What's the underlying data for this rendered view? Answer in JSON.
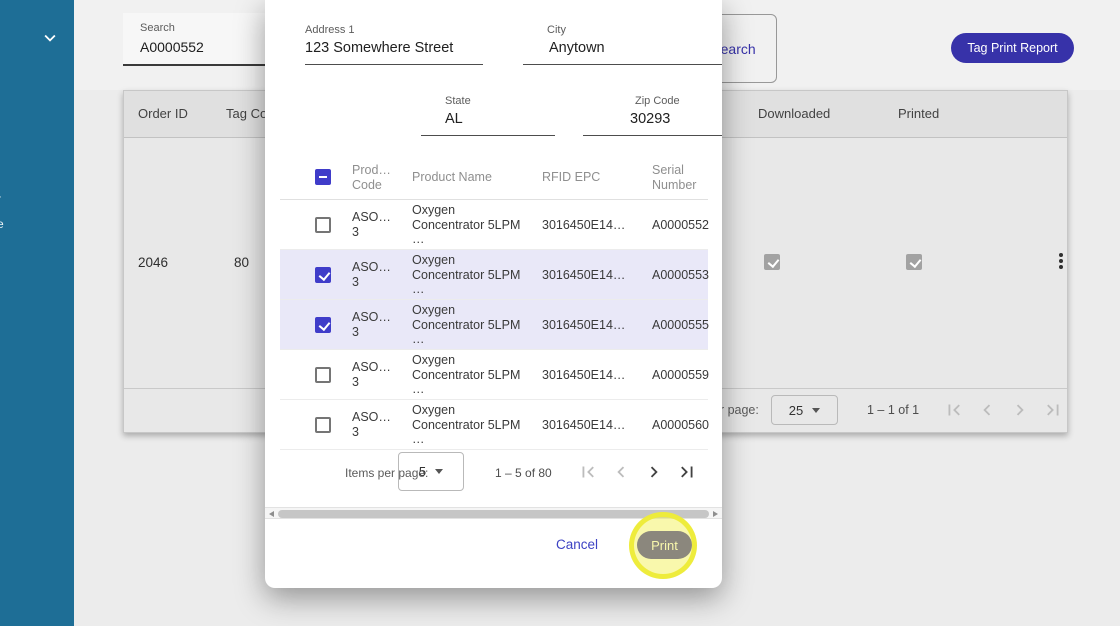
{
  "app": {
    "colors": {
      "sidebar": "#1e6e96",
      "primary_button": "#3732a9",
      "checkbox": "#3f3cc9",
      "selected_row": "#e9e8f8",
      "highlight_yellow": "#eeec3c"
    }
  },
  "sidebar": {
    "fragments": [
      "r",
      "e"
    ]
  },
  "toolbar": {
    "search_label": "Search",
    "search_value": "A0000552",
    "search_button_label": "Search",
    "tag_print_report_label": "Tag Print Report"
  },
  "orders_table": {
    "headers": {
      "order_id": "Order ID",
      "tag_count": "Tag Count",
      "downloaded": "Downloaded",
      "printed": "Printed"
    },
    "row": {
      "order_id": "2046",
      "tag_count": "80",
      "downloaded_checked": true,
      "printed_checked": true
    },
    "paginator": {
      "items_per_page_label": "Items per page:",
      "page_size": "25",
      "range_label": "1 – 1 of 1"
    }
  },
  "dialog": {
    "fields": {
      "address1": {
        "label": "Address 1",
        "value": "123 Somewhere Street"
      },
      "city": {
        "label": "City",
        "value": "Anytown"
      },
      "state": {
        "label": "State",
        "value": "AL"
      },
      "zip": {
        "label": "Zip Code",
        "value": "30293"
      }
    },
    "table": {
      "header_checkbox": "indeterminate",
      "headers": {
        "code": "Prod…\nCode",
        "name": "Product Name",
        "epc": "RFID EPC",
        "serial": "Serial\nNumber"
      },
      "rows": [
        {
          "checked": false,
          "code": "ASO…\n3",
          "name": "Oxygen\nConcentrator 5LPM\n…",
          "epc": "3016450E14…",
          "serial": "A0000552"
        },
        {
          "checked": true,
          "code": "ASO…\n3",
          "name": "Oxygen\nConcentrator 5LPM\n…",
          "epc": "3016450E14…",
          "serial": "A0000553"
        },
        {
          "checked": true,
          "code": "ASO…\n3",
          "name": "Oxygen\nConcentrator 5LPM\n…",
          "epc": "3016450E14…",
          "serial": "A0000555"
        },
        {
          "checked": false,
          "code": "ASO…\n3",
          "name": "Oxygen\nConcentrator 5LPM\n…",
          "epc": "3016450E14…",
          "serial": "A0000559"
        },
        {
          "checked": false,
          "code": "ASO…\n3",
          "name": "Oxygen\nConcentrator 5LPM\n…",
          "epc": "3016450E14…",
          "serial": "A0000560"
        }
      ]
    },
    "paginator": {
      "items_per_page_label": "Items per page:",
      "page_size": "5",
      "range_label": "1 – 5 of 80"
    },
    "actions": {
      "cancel_label": "Cancel",
      "print_label": "Print"
    }
  }
}
